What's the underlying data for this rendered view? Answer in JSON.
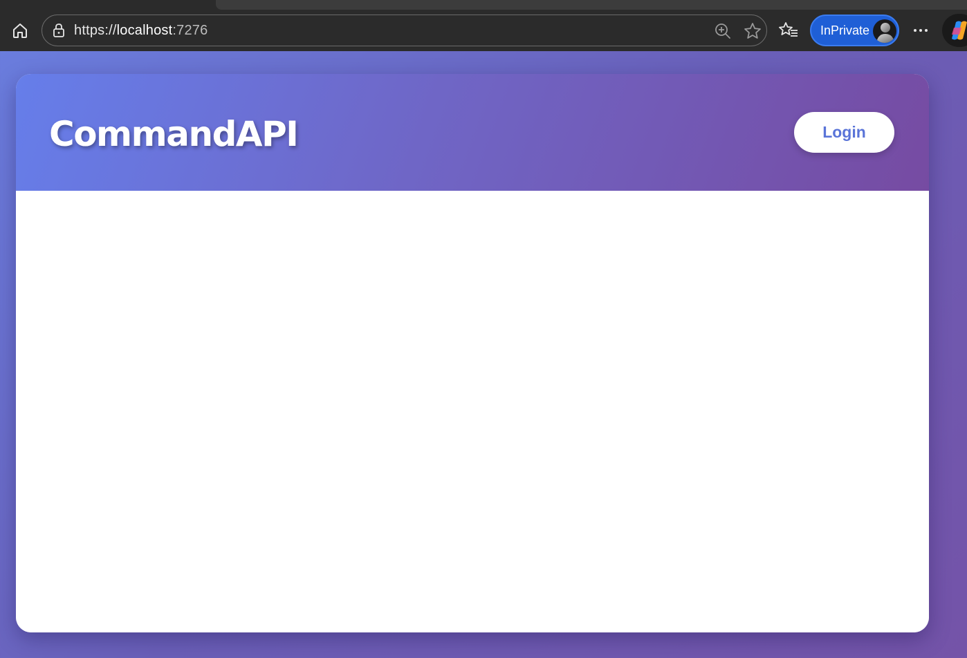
{
  "browser": {
    "url_scheme": "https://",
    "url_host": "localhost",
    "url_port": ":7276",
    "inprivate_label": "InPrivate",
    "icons": [
      "home-icon",
      "lock-icon",
      "zoom-in-icon",
      "star-icon",
      "favorites-icon",
      "avatar-icon",
      "more-icon",
      "copilot-icon"
    ]
  },
  "app": {
    "title": "CommandAPI",
    "login_label": "Login"
  },
  "colors": {
    "header_gradient_start": "#667eea",
    "header_gradient_end": "#764ba2",
    "login_text": "#5a74d8",
    "inprivate_bg": "#1f5fd6"
  }
}
